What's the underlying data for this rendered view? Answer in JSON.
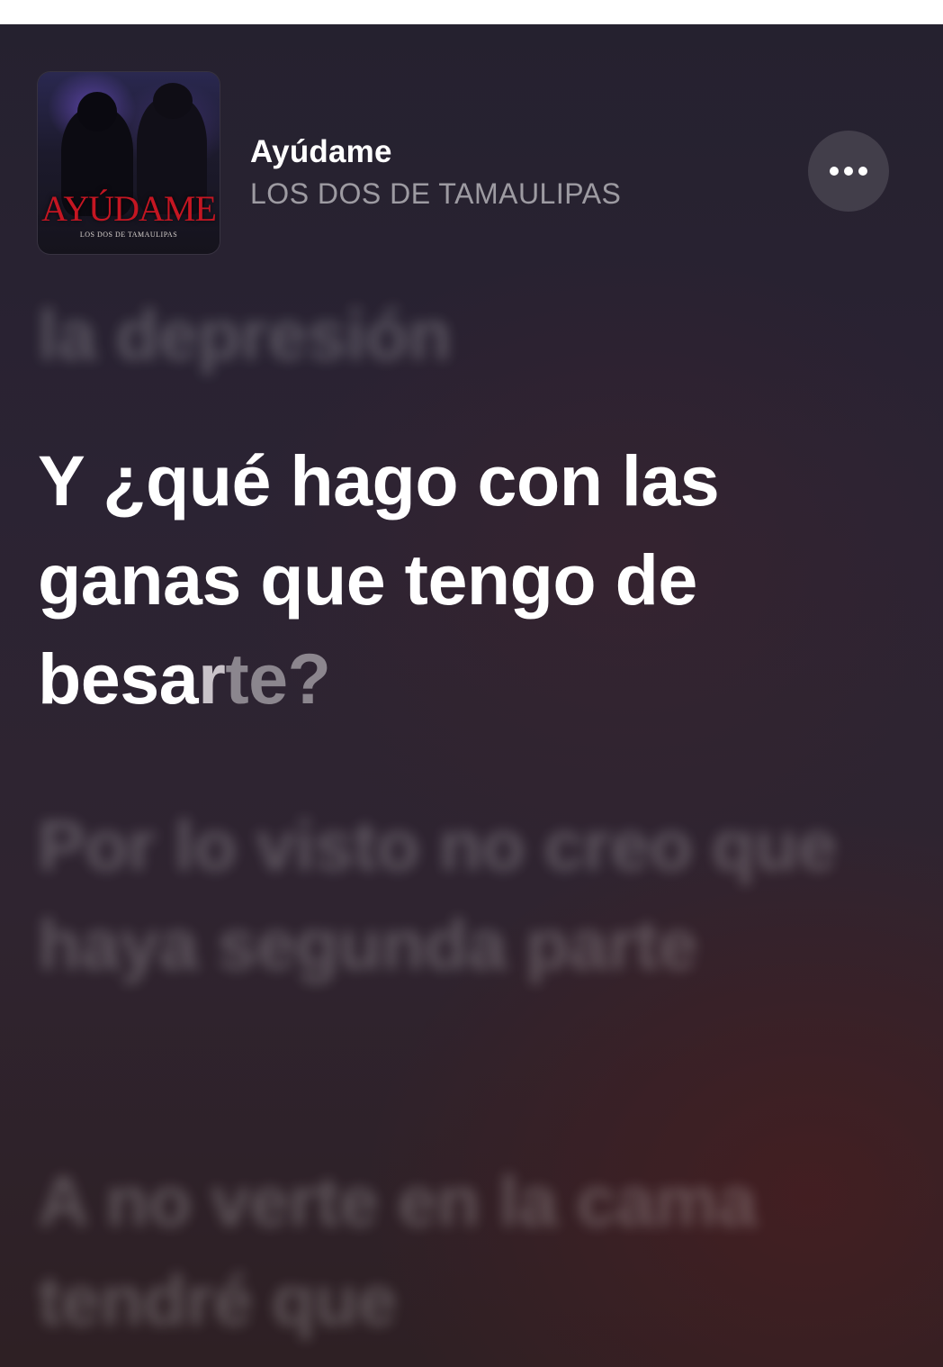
{
  "now_playing": {
    "album_art": {
      "title": "AYÚDAME",
      "subtitle": "LOS DOS DE TAMAULIPAS"
    },
    "title": "Ayúdame",
    "artist": "LOS DOS DE TAMAULIPAS",
    "more_icon": "ellipsis-icon"
  },
  "lyrics": {
    "previous": "la depresión",
    "current": {
      "text_before": "Y ¿qué hago con las ganas que tengo de ",
      "sung": "besa",
      "partial": "r",
      "unsung": "te?"
    },
    "next": [
      "Por lo visto no creo que haya segunda parte",
      "A no verte en la cama tendré que"
    ]
  },
  "colors": {
    "background": "#2b2333",
    "text_active": "#ffffff",
    "album_title": "#c41622"
  }
}
